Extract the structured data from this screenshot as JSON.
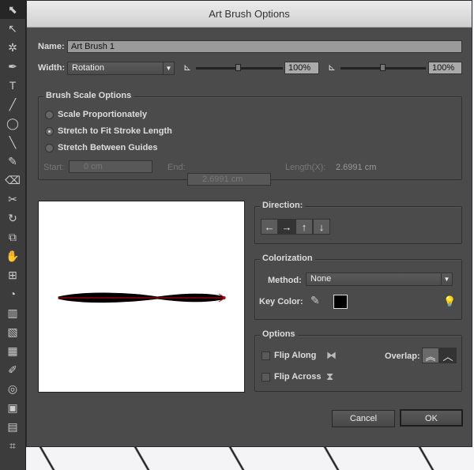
{
  "dialog": {
    "title": "Art Brush Options"
  },
  "name": {
    "label": "Name:",
    "value": "Art Brush 1"
  },
  "width": {
    "label": "Width:",
    "selected": "Rotation",
    "slider1": {
      "value": "100%",
      "level": 50
    },
    "slider2": {
      "value": "100%",
      "level": 50
    }
  },
  "scale": {
    "title": "Brush Scale Options",
    "options": [
      {
        "label": "Scale Proportionately",
        "checked": false
      },
      {
        "label": "Stretch to Fit Stroke Length",
        "checked": true
      },
      {
        "label": "Stretch Between Guides",
        "checked": false
      }
    ],
    "start_label": "Start:",
    "start_value": "0 cm",
    "end_label": "End:",
    "end_value": "2.6991 cm",
    "length_label": "Length(X):",
    "length_value": "2.6991 cm"
  },
  "direction": {
    "title": "Direction:",
    "buttons": [
      "←",
      "→",
      "↑",
      "↓"
    ],
    "selected": 1
  },
  "colorization": {
    "title": "Colorization",
    "method_label": "Method:",
    "method": "None",
    "key_label": "Key Color:",
    "key_color": "#000000"
  },
  "options": {
    "title": "Options",
    "flip_along": "Flip Along",
    "flip_across": "Flip Across",
    "overlap_label": "Overlap:"
  },
  "buttons": {
    "cancel": "Cancel",
    "ok": "OK"
  },
  "toolbar": {
    "icons": [
      "⬉",
      "↖",
      "✲",
      "✒",
      "T",
      "╱",
      "◯",
      "╲",
      "✎",
      "⌫",
      "✂",
      "↻",
      "⧉",
      "✋",
      "⊞",
      "◔",
      "▥",
      "▧",
      "▦",
      "✐",
      "◎",
      "▣",
      "▤",
      "⌗"
    ]
  }
}
